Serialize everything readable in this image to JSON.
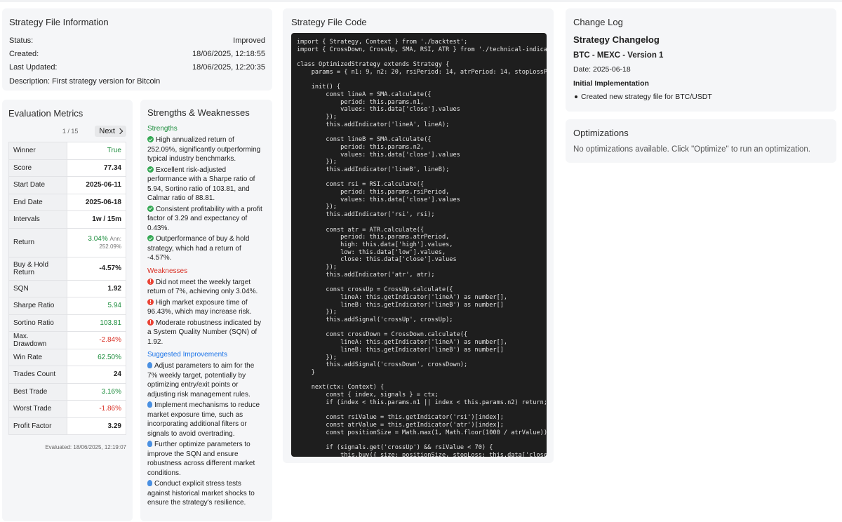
{
  "file_info": {
    "title": "Strategy File Information",
    "rows": [
      {
        "label": "Status:",
        "value": "Improved"
      },
      {
        "label": "Created:",
        "value": "18/06/2025, 12:18:55"
      },
      {
        "label": "Last Updated:",
        "value": "18/06/2025, 12:20:35"
      }
    ],
    "description": "Description: First strategy version for Bitcoin"
  },
  "metrics": {
    "title": "Evaluation Metrics",
    "page": "1 / 15",
    "next_label": "Next",
    "rows": [
      {
        "label": "Winner",
        "value": "True"
      },
      {
        "label": "Score",
        "value": "77.34"
      },
      {
        "label": "Start Date",
        "value": "2025-06-11"
      },
      {
        "label": "End Date",
        "value": "2025-06-18"
      },
      {
        "label": "Intervals",
        "value": "1w / 15m"
      },
      {
        "label": "Return",
        "value": "3.04%",
        "ann_label": "Ann:",
        "ann_value": "252.09%"
      },
      {
        "label": "Buy & Hold Return",
        "value": "-4.57%"
      },
      {
        "label": "SQN",
        "value": "1.92"
      },
      {
        "label": "Sharpe Ratio",
        "value": "5.94"
      },
      {
        "label": "Sortino Ratio",
        "value": "103.81"
      },
      {
        "label": "Max. Drawdown",
        "value": "-2.84%"
      },
      {
        "label": "Win Rate",
        "value": "62.50%"
      },
      {
        "label": "Trades Count",
        "value": "24"
      },
      {
        "label": "Best Trade",
        "value": "3.16%"
      },
      {
        "label": "Worst Trade",
        "value": "-1.86%"
      },
      {
        "label": "Profit Factor",
        "value": "3.29"
      }
    ],
    "evaluated": "Evaluated: 18/06/2025, 12:19:07",
    "colors": {
      "positive": "#1e8e3e",
      "negative": "#d93025"
    }
  },
  "sw": {
    "title": "Strengths & Weaknesses",
    "strengths_title": "Strengths",
    "strengths": [
      "High annualized return of 252.09%, significantly outperforming typical industry benchmarks.",
      "Excellent risk-adjusted performance with a Sharpe ratio of 5.94, Sortino ratio of 103.81, and Calmar ratio of 88.81.",
      "Consistent profitability with a profit factor of 3.29 and expectancy of 0.43%.",
      "Outperformance of buy & hold strategy, which had a return of -4.57%."
    ],
    "weaknesses_title": "Weaknesses",
    "weaknesses": [
      "Did not meet the weekly target return of 7%, achieving only 3.04%.",
      "High market exposure time of 96.43%, which may increase risk.",
      "Moderate robustness indicated by a System Quality Number (SQN) of 1.92."
    ],
    "improvements_title": "Suggested Improvements",
    "improvements": [
      "Adjust parameters to aim for the 7% weekly target, potentially by optimizing entry/exit points or adjusting risk management rules.",
      "Implement mechanisms to reduce market exposure time, such as incorporating additional filters or signals to avoid overtrading.",
      "Further optimize parameters to improve the SQN and ensure robustness across different market conditions.",
      "Conduct explicit stress tests against historical market shocks to ensure the strategy's resilience."
    ]
  },
  "code": {
    "title": "Strategy File Code",
    "source": "import { Strategy, Context } from './backtest';\nimport { CrossDown, CrossUp, SMA, RSI, ATR } from './technical-indicators';\n\nclass OptimizedStrategy extends Strategy {\n    params = { n1: 9, n2: 20, rsiPeriod: 14, atrPeriod: 14, stopLossPct: 0.02 };\n\n    init() {\n        const lineA = SMA.calculate({\n            period: this.params.n1,\n            values: this.data['close'].values\n        });\n        this.addIndicator('lineA', lineA);\n\n        const lineB = SMA.calculate({\n            period: this.params.n2,\n            values: this.data['close'].values\n        });\n        this.addIndicator('lineB', lineB);\n\n        const rsi = RSI.calculate({\n            period: this.params.rsiPeriod,\n            values: this.data['close'].values\n        });\n        this.addIndicator('rsi', rsi);\n\n        const atr = ATR.calculate({\n            period: this.params.atrPeriod,\n            high: this.data['high'].values,\n            low: this.data['low'].values,\n            close: this.data['close'].values\n        });\n        this.addIndicator('atr', atr);\n\n        const crossUp = CrossUp.calculate({\n            lineA: this.getIndicator('lineA') as number[],\n            lineB: this.getIndicator('lineB') as number[]\n        });\n        this.addSignal('crossUp', crossUp);\n\n        const crossDown = CrossDown.calculate({\n            lineA: this.getIndicator('lineA') as number[],\n            lineB: this.getIndicator('lineB') as number[]\n        });\n        this.addSignal('crossDown', crossDown);\n    }\n\n    next(ctx: Context) {\n        const { index, signals } = ctx;\n        if (index < this.params.n1 || index < this.params.n2) return;\n\n        const rsiValue = this.getIndicator('rsi')[index];\n        const atrValue = this.getIndicator('atr')[index];\n        const positionSize = Math.max(1, Math.floor(1000 / atrValue));\n\n        if (signals.get('crossUp') && rsiValue < 70) {\n            this.buy({ size: positionSize, stopLoss: this.data['close'].values[index] });"
  },
  "changelog": {
    "title": "Change Log",
    "heading": "Strategy Changelog",
    "version": "BTC - MEXC - Version 1",
    "date": "Date: 2025-06-18",
    "section": "Initial Implementation",
    "items": [
      "Created new strategy file for BTC/USDT"
    ]
  },
  "optimizations": {
    "title": "Optimizations",
    "text": "No optimizations available. Click \"Optimize\" to run an optimization."
  }
}
